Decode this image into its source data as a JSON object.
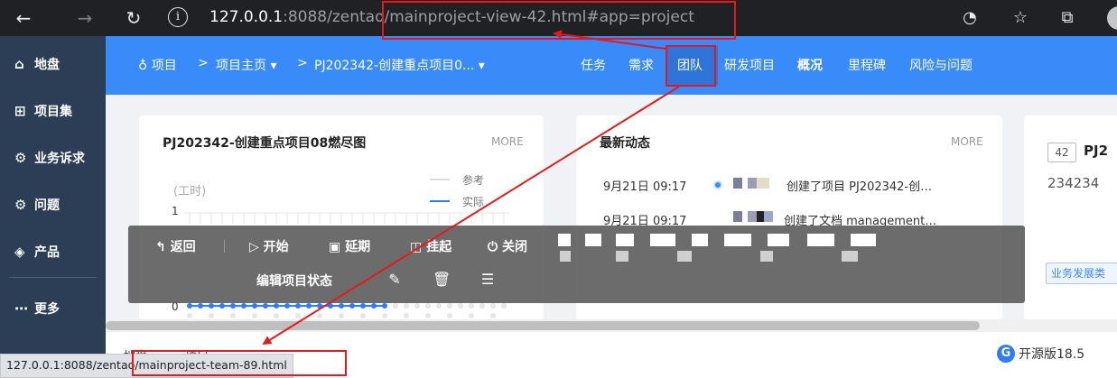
{
  "browser": {
    "url_host": "127.0.0.1",
    "url_rest": ":8088/zentao/mainproject-view-42.html#app=project",
    "status_url": "127.0.0.1:8088/zentao/mainproject-team-89.html"
  },
  "sidebar": {
    "items": [
      {
        "label": "地盘",
        "icon": "⌂"
      },
      {
        "label": "项目集",
        "icon": "⊞"
      },
      {
        "label": "业务诉求",
        "icon": "⚙"
      },
      {
        "label": "问题",
        "icon": "⚙"
      },
      {
        "label": "产品",
        "icon": "◈"
      },
      {
        "label": "更多",
        "icon": "⋯"
      }
    ]
  },
  "topnav": {
    "breadcrumb": {
      "root": "项目",
      "sep": ">",
      "home": "项目主页",
      "project": "PJ202342-创建重点项目0..."
    },
    "tabs": [
      "任务",
      "需求",
      "团队",
      "研发项目",
      "概况",
      "里程碑",
      "风险与问题"
    ]
  },
  "burndown": {
    "title": "PJ202342-创建重点项目08燃尽图",
    "more": "MORE",
    "legend_ref": "参考",
    "legend_actual": "实际",
    "unit": "(工时)",
    "y_top": "1",
    "y_bottom": "0"
  },
  "feed": {
    "title": "最新动态",
    "more": "MORE",
    "items": [
      {
        "time": "9月21日 09:17",
        "text": "创建了项目 PJ202342-创…"
      },
      {
        "time": "9月21日 09:17",
        "text": "创建了文档 management…"
      }
    ]
  },
  "project_card": {
    "id": "42",
    "name": "PJ2",
    "desc": "234234",
    "tag": "业务发展类"
  },
  "toolbar": {
    "back": "返回",
    "start": "开始",
    "delay": "延期",
    "suspend": "挂起",
    "close": "关闭",
    "edit_status": "编辑项目状态"
  },
  "footer": {
    "crumb_left": "地盘",
    "crumb_right": "项目",
    "version": "开源版18.5"
  },
  "colors": {
    "primary": "#3a8bfa",
    "sidebar": "#2c3e55",
    "annotation": "#e51919"
  }
}
